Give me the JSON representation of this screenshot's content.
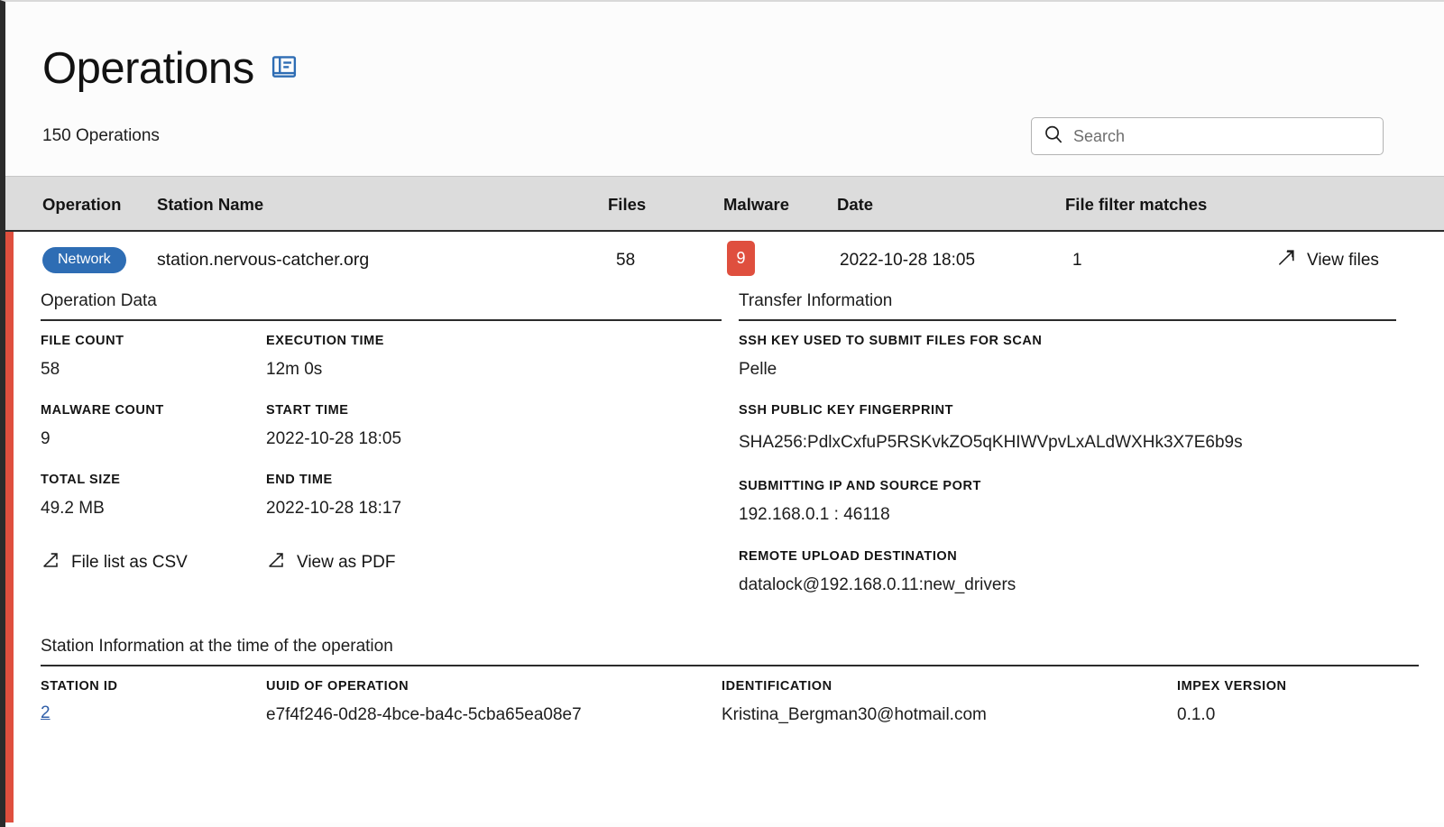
{
  "header": {
    "title": "Operations",
    "manual_icon": "book-manual-icon",
    "count_label": "150 Operations",
    "search": {
      "icon": "search-icon",
      "placeholder": "Search",
      "value": ""
    }
  },
  "table": {
    "columns": [
      {
        "key": "operation",
        "label": "Operation"
      },
      {
        "key": "station",
        "label": "Station Name"
      },
      {
        "key": "files",
        "label": "Files"
      },
      {
        "key": "malware",
        "label": "Malware"
      },
      {
        "key": "date",
        "label": "Date"
      },
      {
        "key": "filter",
        "label": "File filter matches"
      }
    ],
    "row": {
      "operation_badge": "Network",
      "station_name": "station.nervous-catcher.org",
      "files": "58",
      "malware": "9",
      "date": "2022-10-28 18:05",
      "file_filter_matches": "1",
      "view_files_label": "View files",
      "view_files_icon": "external-link-icon",
      "accent_color": "#df4f3e",
      "badge_color": "#2e6db4",
      "malware_color": "#df4f3e"
    }
  },
  "operation_data": {
    "section_title": "Operation Data",
    "fields": [
      {
        "label": "FILE COUNT",
        "value": "58"
      },
      {
        "label": "EXECUTION TIME",
        "value": "12m 0s"
      },
      {
        "label": "MALWARE COUNT",
        "value": "9"
      },
      {
        "label": "START TIME",
        "value": "2022-10-28 18:05"
      },
      {
        "label": "TOTAL SIZE",
        "value": "49.2 MB"
      },
      {
        "label": "END TIME",
        "value": "2022-10-28 18:17"
      }
    ],
    "links": [
      {
        "label": "File list as CSV",
        "icon": "external-link-icon"
      },
      {
        "label": "View as PDF",
        "icon": "external-link-icon"
      }
    ]
  },
  "transfer_information": {
    "section_title": "Transfer Information",
    "fields": [
      {
        "label": "SSH KEY USED TO SUBMIT FILES FOR SCAN",
        "value": "Pelle"
      },
      {
        "label": "SSH PUBLIC KEY FINGERPRINT",
        "value": "SHA256:PdlxCxfuP5RSKvkZO5qKHIWVpvLxALdWXHk3X7E6b9s"
      },
      {
        "label": "SUBMITTING IP AND SOURCE PORT",
        "value": "192.168.0.1 : 46118"
      },
      {
        "label": "REMOTE UPLOAD DESTINATION",
        "value": "datalock@192.168.0.11:new_drivers"
      }
    ]
  },
  "station_information": {
    "section_title": "Station Information at the time of the operation",
    "fields": [
      {
        "label": "STATION ID",
        "value": "2",
        "is_link": true
      },
      {
        "label": "UUID OF OPERATION",
        "value": "e7f4f246-0d28-4bce-ba4c-5cba65ea08e7"
      },
      {
        "label": "IDENTIFICATION",
        "value": "Kristina_Bergman30@hotmail.com"
      },
      {
        "label": "IMPEX VERSION",
        "value": "0.1.0"
      }
    ]
  }
}
